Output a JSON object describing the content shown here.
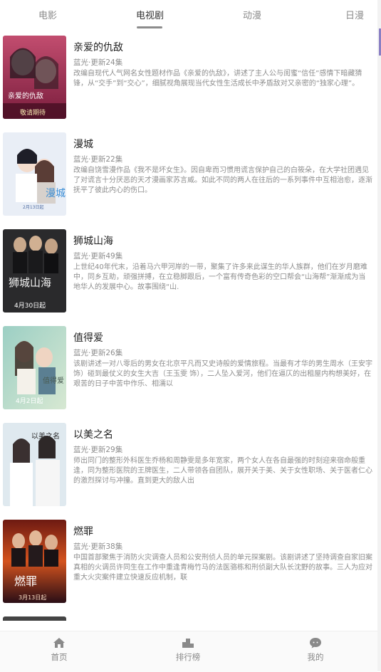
{
  "tabs": [
    {
      "label": "电影",
      "active": false
    },
    {
      "label": "电视剧",
      "active": true
    },
    {
      "label": "动漫",
      "active": false
    },
    {
      "label": "日漫",
      "active": false
    }
  ],
  "items": [
    {
      "title": "亲爱的仇敌",
      "meta": "蓝光·更新24集",
      "poster_text": "亲爱的仇敌",
      "poster_sub": "敬请期待",
      "desc": "改编自现代人气网名女性题材作品《亲爱的仇敌》，讲述了主人公与闺蜜“信任”感情下暗藏猜锋，从“交手”到“交心”，细腻视角展现当代女性生活成长中矛盾敌对又亲密的“独家心理”。"
    },
    {
      "title": "漫城",
      "meta": "蓝光·更新22集",
      "poster_text": "漫城",
      "poster_sub": "2月13日起",
      "desc": "改编自饶雪漫作品《我不是坏女生》。因自卑而习惯用谎言保护自己的白筱朵，在大学社团遇见了对谎言十分厌恶的天才漫画家苏言威。如此不同的两人在往后的一系列事件中互相治愈，逐渐抚平了彼此内心的伤口。"
    },
    {
      "title": "狮城山海",
      "meta": "蓝光·更新49集",
      "poster_text": "狮城山海",
      "poster_sub": "4月30日起",
      "desc": "上世纪40年代末，沿着马六甲河岸的一带，聚集了许多来此谋生的华人族群，他们在岁月磨难中，同乡互助，顽强拼搏，在立稳脚跟后，一个富有传奇色彩的空口帮会“山海帮”渐渐成为当地华人的发展中心。故事围绕“山."
    },
    {
      "title": "值得爱",
      "meta": "蓝光·更新26集",
      "poster_text": "值得爱",
      "poster_sub": "4月2日起",
      "desc": "该剧讲述一对八零后的男女在北京平凡而又史诗般的爱情旅程。当最有才华的男生周水（王安宇 饰）碰到最仗义的女生大吉（王玉雯 饰），二人坠入爱河，他们在逼仄的出租屋内构想美好，在艰苦的日子中苦中作乐、相濡以"
    },
    {
      "title": "以美之名",
      "meta": "蓝光·更新29集",
      "poster_text": "以美之名",
      "poster_sub": "",
      "desc": "师出同门的整形外科医生乔杨和周静雯是多年宽家，两个女人在各自最强的时刻迎来宿命般重逢，同为整形医院的王牌医生，二人带领各自团队，展开关于美、关于女性职场、关于医者仁心的激烈探讨与冲撞。直到更大的敌人出"
    },
    {
      "title": "燃罪",
      "meta": "蓝光·更新38集",
      "poster_text": "燃罪",
      "poster_sub": "3月13日起",
      "desc": "中国首部聚焦于消防火灾调查人员和公安刑侦人员的单元探案剧。该剧讲述了坚持调查自家旧案真相的火调员许同生在工作中重逢青梅竹马的法医骆栋和刑侦副大队长沈野的故事。三人为应对重大火灾案件建立快速反应机制，联"
    }
  ],
  "bottom_nav": [
    {
      "label": "首页",
      "icon": "home-icon"
    },
    {
      "label": "排行榜",
      "icon": "podium-icon"
    },
    {
      "label": "我的",
      "icon": "chat-bubble-icon"
    }
  ],
  "colors": {
    "accent_edge": "#8a7fc4",
    "indicator": "#8c8c8c",
    "text_muted": "#8d8d8d"
  }
}
